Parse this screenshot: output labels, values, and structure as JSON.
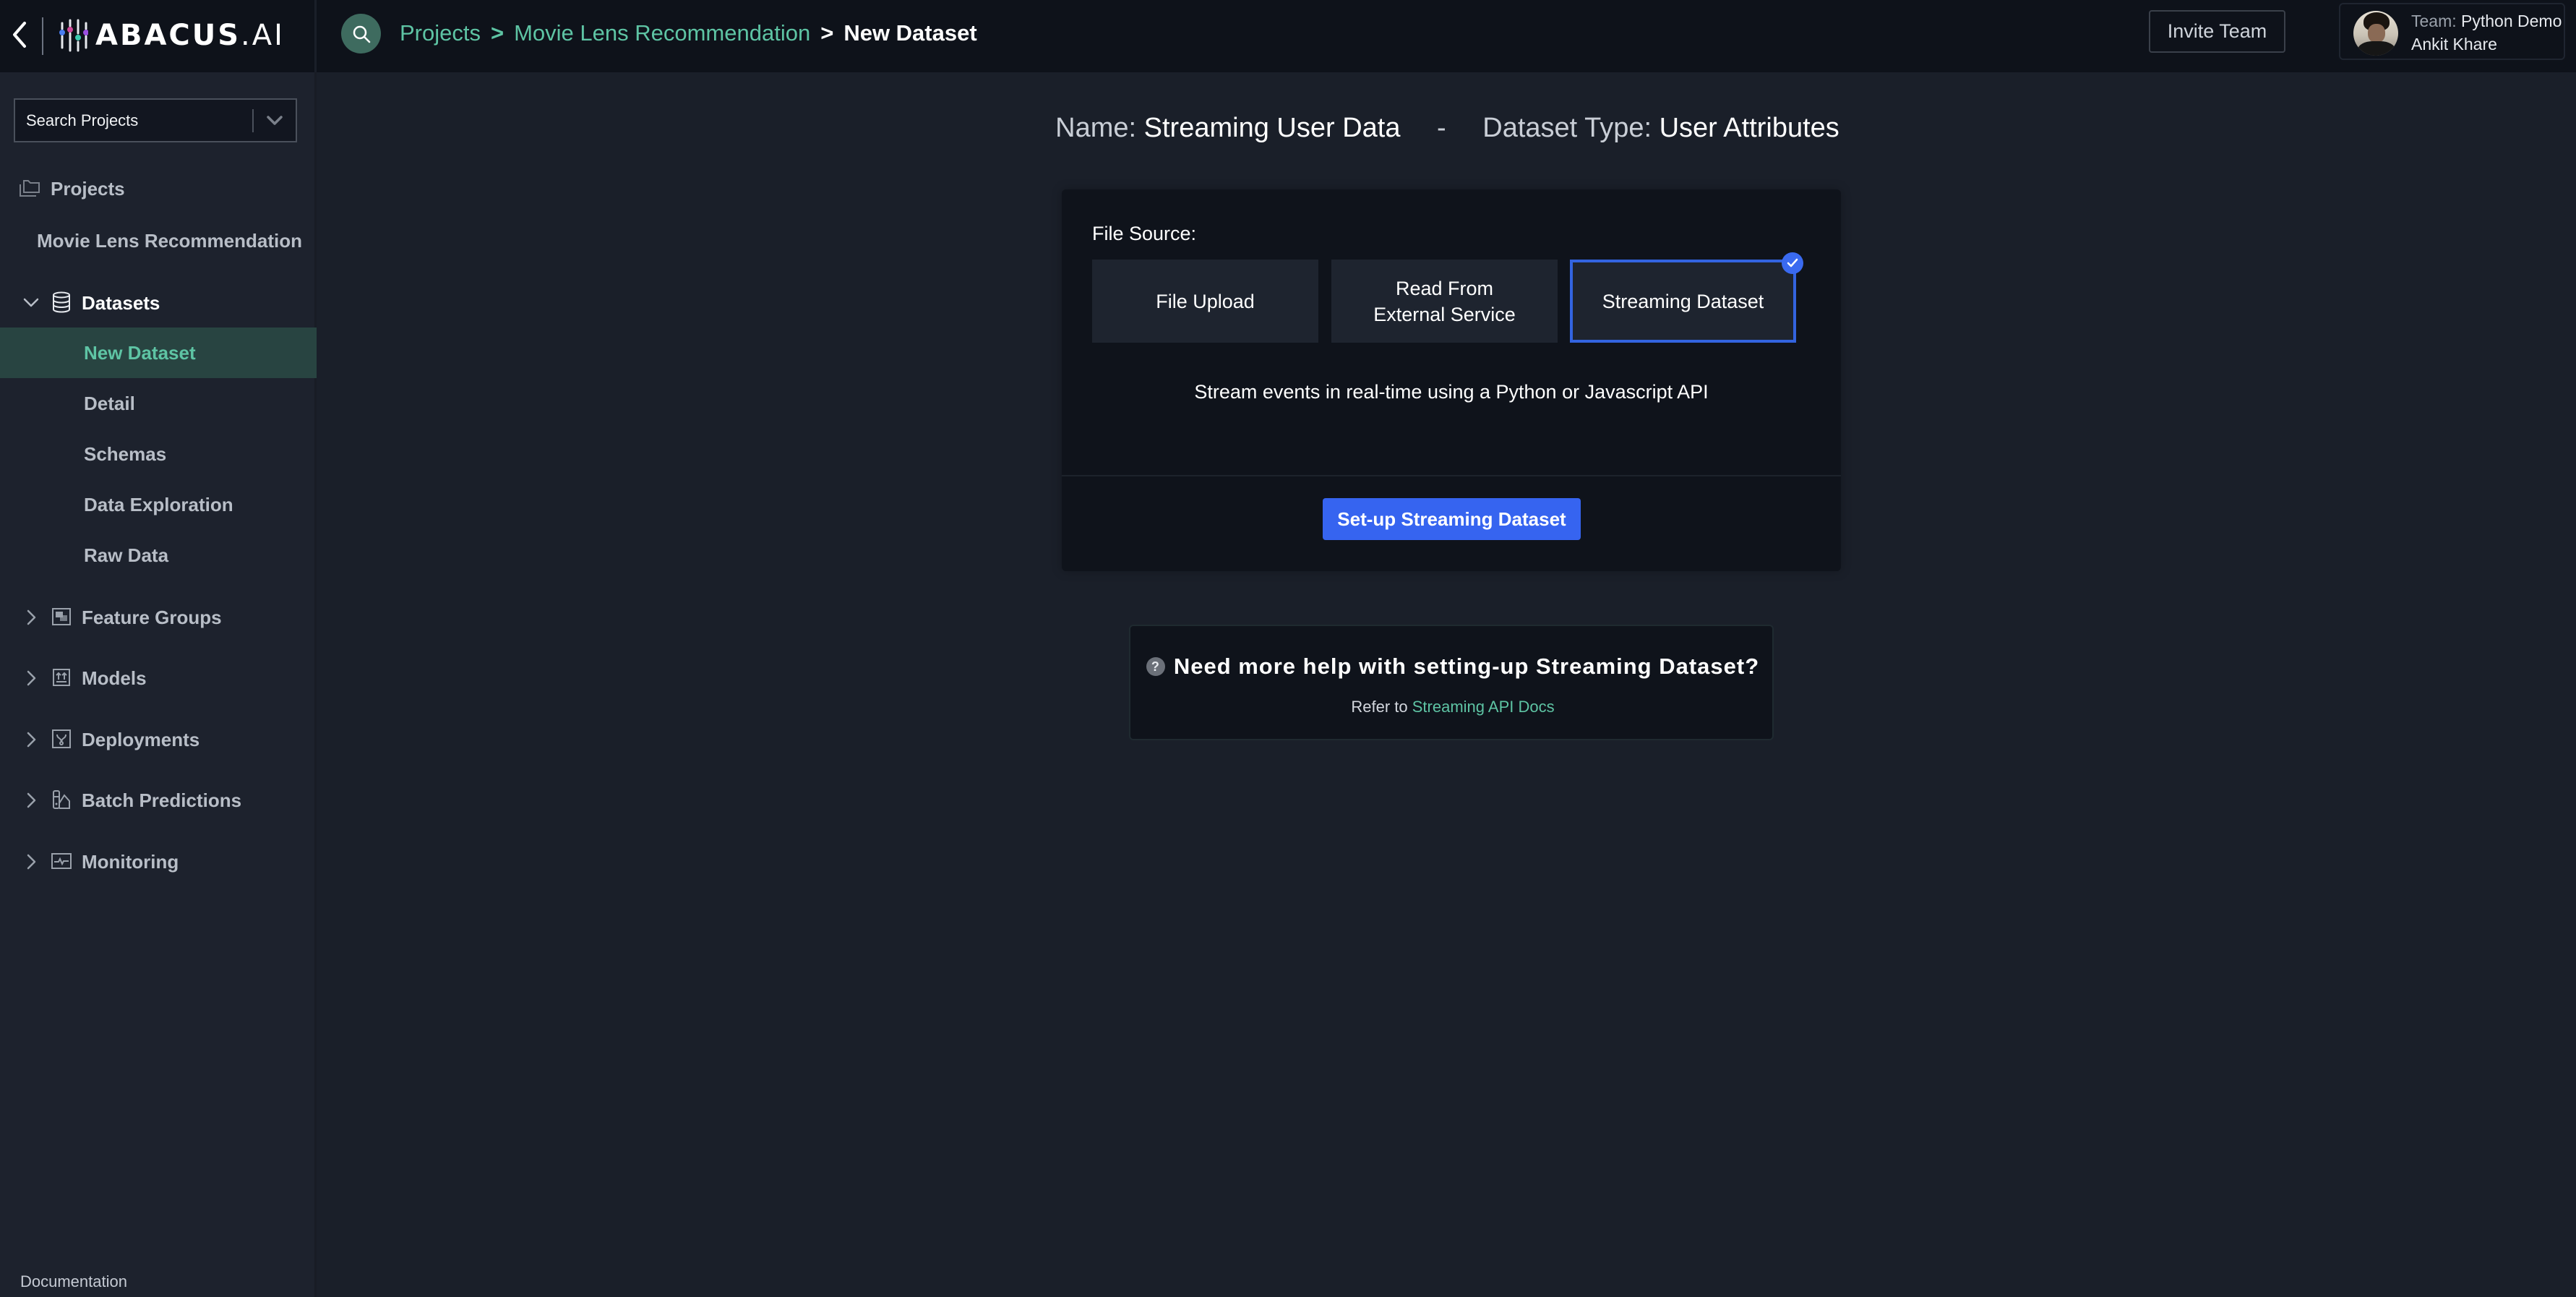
{
  "app": {
    "brand": "ABACUS.AI",
    "brand_main": "ABACUS",
    "brand_suffix": ".AI"
  },
  "colors": {
    "accent_green": "#5ec4a4",
    "primary_blue": "#3664f0",
    "selected_row_bg": "#284441",
    "header_bg": "#0e121a",
    "sidebar_bg": "#1d222d",
    "main_bg": "#1a1f29"
  },
  "header": {
    "breadcrumb": [
      {
        "label": "Projects"
      },
      {
        "label": "Movie Lens Recommendation"
      },
      {
        "label": "New Dataset"
      }
    ],
    "breadcrumb_separator": ">",
    "invite_label": "Invite Team",
    "user": {
      "team_label": "Team:",
      "team_name": "Python Demo",
      "name": "Ankit Khare"
    }
  },
  "sidebar": {
    "search_placeholder": "Search Projects",
    "projects_label": "Projects",
    "current_project": "Movie Lens Recommendation",
    "sections": [
      {
        "label": "Datasets",
        "icon": "database-icon",
        "expanded": true
      },
      {
        "label": "Feature Groups",
        "icon": "feature-groups-icon",
        "expanded": false
      },
      {
        "label": "Models",
        "icon": "models-icon",
        "expanded": false
      },
      {
        "label": "Deployments",
        "icon": "deployments-icon",
        "expanded": false
      },
      {
        "label": "Batch Predictions",
        "icon": "batch-predictions-icon",
        "expanded": false
      },
      {
        "label": "Monitoring",
        "icon": "monitoring-icon",
        "expanded": false
      }
    ],
    "dataset_items": [
      {
        "label": "New Dataset",
        "active": true
      },
      {
        "label": "Detail",
        "active": false
      },
      {
        "label": "Schemas",
        "active": false
      },
      {
        "label": "Data Exploration",
        "active": false
      },
      {
        "label": "Raw Data",
        "active": false
      }
    ],
    "documentation_label": "Documentation"
  },
  "main": {
    "name_label": "Name:",
    "name_value": "Streaming User Data",
    "dash": "-",
    "type_label": "Dataset Type:",
    "type_value": "User Attributes",
    "file_source_label": "File Source:",
    "file_source_options": [
      {
        "label": "File Upload",
        "selected": false
      },
      {
        "label": "Read From External Service",
        "selected": false
      },
      {
        "label": "Streaming Dataset",
        "selected": true
      }
    ],
    "description": "Stream events in real-time using a Python or Javascript API",
    "setup_button_label": "Set-up Streaming Dataset",
    "help": {
      "icon": "?",
      "title": "Need more help with setting-up Streaming Dataset?",
      "refer_prefix": "Refer to",
      "link_label": "Streaming API Docs"
    }
  }
}
